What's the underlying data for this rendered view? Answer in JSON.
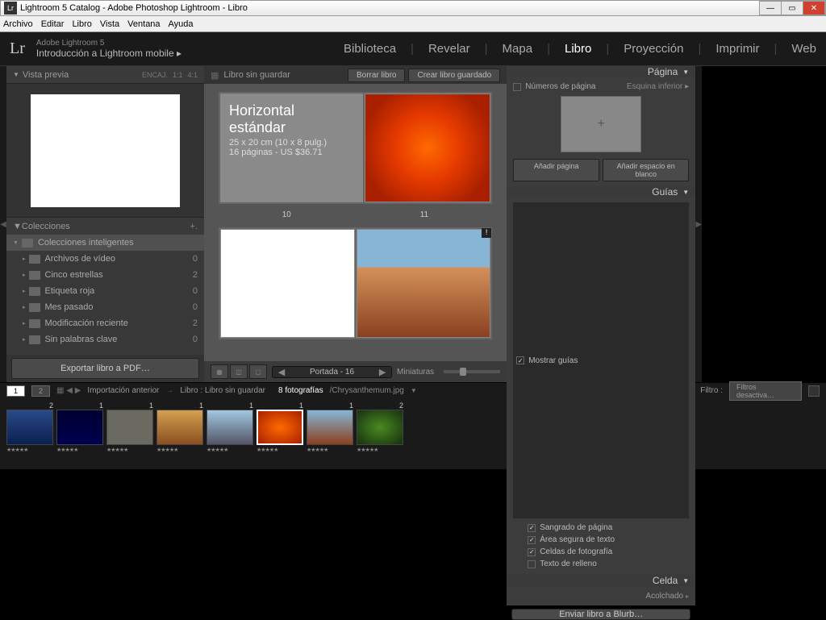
{
  "titlebar": {
    "title": "Lightroom 5 Catalog - Adobe Photoshop Lightroom - Libro"
  },
  "menubar": [
    "Archivo",
    "Editar",
    "Libro",
    "Vista",
    "Ventana",
    "Ayuda"
  ],
  "header": {
    "brand": "Lr",
    "product": "Adobe Lightroom 5",
    "intro": "Introducción a Lightroom mobile  ▸"
  },
  "modules": [
    "Biblioteca",
    "Revelar",
    "Mapa",
    "Libro",
    "Proyección",
    "Imprimir",
    "Web"
  ],
  "activeModule": "Libro",
  "leftPanel": {
    "preview": {
      "title": "Vista previa",
      "opts": [
        "ENCAJ.",
        "1:1",
        "4:1"
      ]
    },
    "collections": {
      "title": "Colecciones",
      "smartHeader": "Colecciones inteligentes",
      "items": [
        {
          "name": "Archivos de vídeo",
          "count": "0"
        },
        {
          "name": "Cinco estrellas",
          "count": "2"
        },
        {
          "name": "Etiqueta roja",
          "count": "0"
        },
        {
          "name": "Mes pasado",
          "count": "0"
        },
        {
          "name": "Modificación reciente",
          "count": "2"
        },
        {
          "name": "Sin palabras clave",
          "count": "0"
        }
      ]
    },
    "export": "Exportar libro a PDF…"
  },
  "center": {
    "unsaved": "Libro sin guardar",
    "clearBtn": "Borrar libro",
    "createBtn": "Crear libro guardado",
    "bookTitle": "Horizontal estándar",
    "bookSize": "25 x 20 cm (10 x 8 pulg.)",
    "bookPages": "16 páginas - US $36.71",
    "pageL": "10",
    "pageR": "11",
    "pagerLabel": "Portada - 16",
    "thumbsLabel": "Miniaturas"
  },
  "rightPanel": {
    "page": {
      "title": "Página",
      "numLabel": "Números de página",
      "corner": "Esquina inferior ▸",
      "addPage": "Añadir página",
      "addBlank": "Añadir espacio en blanco"
    },
    "guides": {
      "title": "Guías",
      "show": "Mostrar guías",
      "items": [
        {
          "label": "Sangrado de página",
          "on": true
        },
        {
          "label": "Área segura de texto",
          "on": true
        },
        {
          "label": "Celdas de fotografía",
          "on": true
        },
        {
          "label": "Texto de relleno",
          "on": false
        }
      ]
    },
    "cell": {
      "title": "Celda",
      "padded": "Acolchado"
    },
    "blurb": "Enviar libro a Blurb…"
  },
  "status": {
    "prevImport": "Importación anterior",
    "bookLabel": "Libro : Libro sin guardar",
    "photoCount": "8 fotografías",
    "filename": "/Chrysanthemum.jpg",
    "filterLabel": "Filtro :",
    "filterValue": "Filtros desactiva…"
  },
  "filmstrip": [
    {
      "badge": "2",
      "bg": "linear-gradient(#2a4a8a,#0a2050)"
    },
    {
      "badge": "1",
      "bg": "linear-gradient(#000030,#000050)"
    },
    {
      "badge": "1",
      "bg": "#6a6a60"
    },
    {
      "badge": "1",
      "bg": "linear-gradient(#d4a050,#8a5020)"
    },
    {
      "badge": "1",
      "bg": "linear-gradient(#a0c8e0,#556)"
    },
    {
      "badge": "1",
      "bg": "radial-gradient(#ff6a00,#a82000)",
      "sel": true
    },
    {
      "badge": "1",
      "bg": "linear-gradient(#87b5d6,#8a4020)"
    },
    {
      "badge": "2",
      "bg": "radial-gradient(#4a8a20,#163010)"
    }
  ]
}
